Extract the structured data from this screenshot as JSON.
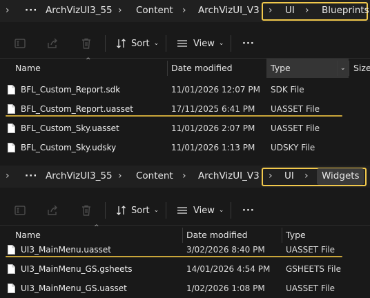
{
  "top_pane": {
    "breadcrumb": {
      "items": [
        "ArchVizUI3_55",
        "Content",
        "ArchVizUI_V3",
        "UI",
        "Blueprints"
      ],
      "more": "···"
    },
    "toolbar": {
      "sort_label": "Sort",
      "view_label": "View",
      "more_label": "···"
    },
    "columns": {
      "name": "Name",
      "date": "Date modified",
      "type": "Type",
      "size": "Size"
    },
    "rows": [
      {
        "name": "BFL_Custom_Report.sdk",
        "date": "11/01/2026 12:07 PM",
        "type": "SDK File"
      },
      {
        "name": "BFL_Custom_Report.uasset",
        "date": "17/11/2025 6:41 PM",
        "type": "UASSET File"
      },
      {
        "name": "BFL_Custom_Sky.uasset",
        "date": "11/01/2026 2:07 PM",
        "type": "UASSET File"
      },
      {
        "name": "BFL_Custom_Sky.udsky",
        "date": "11/01/2026 1:13 PM",
        "type": "UDSKY File"
      }
    ]
  },
  "bottom_pane": {
    "breadcrumb": {
      "items": [
        "ArchVizUI3_55",
        "Content",
        "ArchVizUI_V3",
        "UI",
        "Widgets"
      ],
      "more": "···"
    },
    "toolbar": {
      "sort_label": "Sort",
      "view_label": "View",
      "more_label": "···"
    },
    "columns": {
      "name": "Name",
      "date": "Date modified",
      "type": "Type"
    },
    "rows": [
      {
        "name": "UI3_MainMenu.uasset",
        "date": "3/02/2026 8:40 PM",
        "type": "UASSET File"
      },
      {
        "name": "UI3_MainMenu_GS.gsheets",
        "date": "14/01/2026 4:54 PM",
        "type": "GSHEETS File"
      },
      {
        "name": "UI3_MainMenu_GS.uasset",
        "date": "1/02/2026 1:08 PM",
        "type": "UASSET File"
      }
    ]
  },
  "colors": {
    "highlight": "#f2c94c",
    "underline": "#c9a53a",
    "background": "#191919"
  },
  "icons": [
    "chevron-right-icon",
    "rename-icon",
    "share-icon",
    "delete-icon",
    "sort-icon",
    "view-icon",
    "file-icon"
  ]
}
